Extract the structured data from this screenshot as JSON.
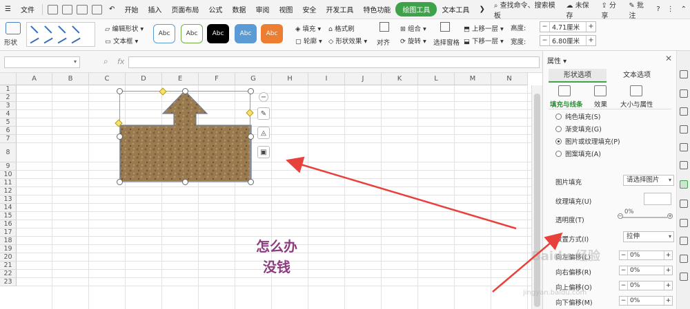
{
  "menubar": {
    "file_label": "文件",
    "tabs": [
      "开始",
      "插入",
      "页面布局",
      "公式",
      "数据",
      "审阅",
      "视图",
      "安全",
      "开发工具",
      "特色功能",
      "绘图工具",
      "文本工具"
    ],
    "active_tab": "绘图工具",
    "search_label": "查找命令、搜索模板",
    "unsaved_label": "未保存",
    "share_label": "分享",
    "comment_label": "批注"
  },
  "ribbon": {
    "shape_label": "形状",
    "edit_shape_label": "编辑形状",
    "textbox_label": "文本框",
    "style_labels": [
      "Abc",
      "Abc",
      "Abc",
      "Abc",
      "Abc"
    ],
    "style_colors": [
      "#ffffff",
      "#ffffff",
      "#000000",
      "#5b9bd5",
      "#ed7d31"
    ],
    "fill_label": "填充",
    "format_brush_label": "格式刷",
    "outline_label": "轮廓",
    "shape_effect_label": "形状效果",
    "align_label": "对齐",
    "group_label": "组合",
    "rotate_label": "旋转",
    "select_pane_label": "选择窗格",
    "bring_forward_label": "上移一层",
    "send_backward_label": "下移一层",
    "height_label": "高度:",
    "height_value": "4.71厘米",
    "width_label": "宽度:",
    "width_value": "6.80厘米"
  },
  "formula": {
    "fx_label": "fx",
    "name_value": "",
    "formula_value": ""
  },
  "sheet": {
    "columns": [
      "A",
      "B",
      "C",
      "D",
      "E",
      "F",
      "G",
      "H",
      "I",
      "J",
      "K",
      "L",
      "M",
      "N"
    ],
    "rows": [
      "1",
      "2",
      "3",
      "4",
      "5",
      "6",
      "7",
      "8",
      "9",
      "10",
      "11",
      "12",
      "13",
      "14",
      "15",
      "16",
      "17",
      "18",
      "19",
      "20",
      "21",
      "22",
      "23"
    ],
    "annotation_line1": "怎么办",
    "annotation_line2": "没钱"
  },
  "pane": {
    "title": "属性",
    "tabs": [
      "形状选项",
      "文本选项"
    ],
    "subtabs": [
      "填充与线条",
      "效果",
      "大小与属性"
    ],
    "fill_options": [
      "纯色填充(S)",
      "渐变填充(G)",
      "图片或纹理填充(P)",
      "图案填充(A)"
    ],
    "selected_fill": "图片或纹理填充(P)",
    "picture_fill_label": "图片填充",
    "picture_fill_value": "请选择图片",
    "texture_fill_label": "纹理填充(U)",
    "transparency_label": "透明度(T)",
    "transparency_value": "0%",
    "placement_label": "放置方式(I)",
    "placement_value": "拉伸",
    "offset_rows": [
      {
        "label": "向左偏移(L)",
        "value": "0%"
      },
      {
        "label": "向右偏移(R)",
        "value": "0%"
      },
      {
        "label": "向上偏移(O)",
        "value": "0%"
      },
      {
        "label": "向下偏移(M)",
        "value": "0%"
      }
    ]
  },
  "watermark": {
    "text": "Baidu 经验",
    "url": "jingyan.baidu.com"
  },
  "colors": {
    "accent": "#3ea24a",
    "annotation": "#8b3d7f",
    "arrow": "#e8413b"
  }
}
